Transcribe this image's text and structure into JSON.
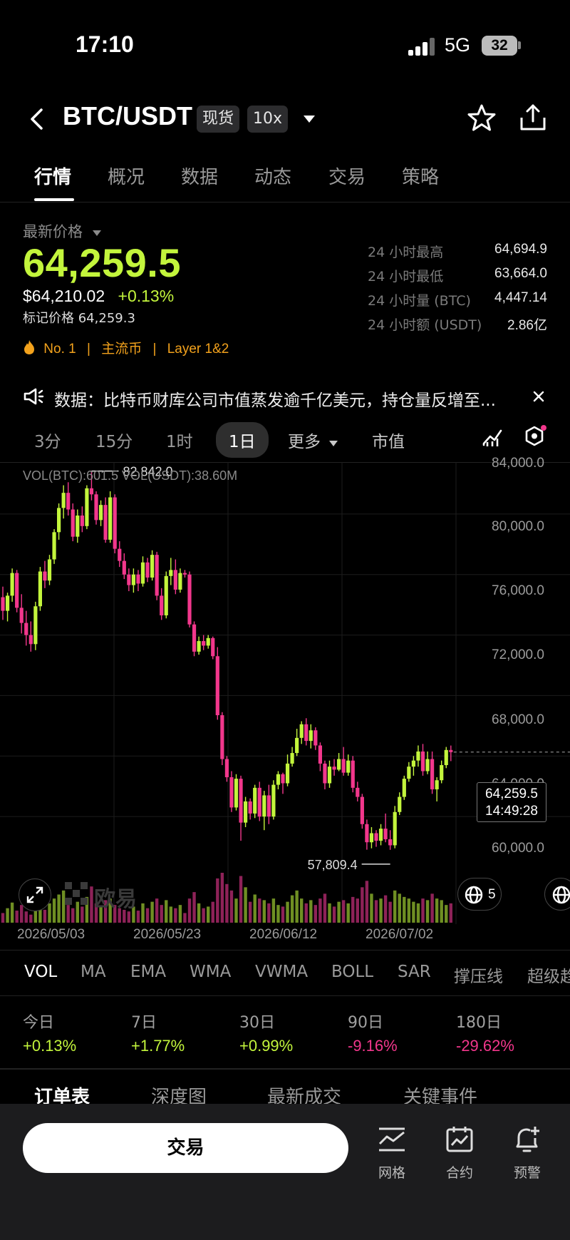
{
  "status_bar": {
    "time": "17:10",
    "network": "5G",
    "battery": "32"
  },
  "header": {
    "pair": "BTC/USDT",
    "tag_market": "现货",
    "tag_leverage": "10x"
  },
  "tabs": [
    "行情",
    "概况",
    "数据",
    "动态",
    "交易",
    "策略"
  ],
  "price": {
    "label": "最新价格",
    "last": "64,259.5",
    "usd": "$64,210.02",
    "change": "+0.13%",
    "mark_label": "标记价格",
    "mark_value": "64,259.3"
  },
  "badges": {
    "rank": "No. 1",
    "sep": "|",
    "category": "主流币",
    "layer": "Layer 1&2"
  },
  "stats": [
    {
      "label": "24 小时最高",
      "value": "64,694.9"
    },
    {
      "label": "24 小时最低",
      "value": "63,664.0"
    },
    {
      "label": "24 小时量 (BTC)",
      "value": "4,447.14"
    },
    {
      "label": "24 小时额 (USDT)",
      "value": "2.86亿"
    }
  ],
  "news": {
    "text": "数据：比特币财库公司市值蒸发逾千亿美元，持仓量反增至..."
  },
  "timeframes": [
    "3分",
    "15分",
    "1时",
    "1日",
    "更多",
    "市值"
  ],
  "chart": {
    "vol_info": "VOL(BTC):601.5 VOL(USDT):38.60M",
    "high_label": "82,842.0",
    "low_label": "57,809.4",
    "y_ticks": [
      "84,000.0",
      "80,000.0",
      "76,000.0",
      "72,000.0",
      "68,000.0",
      "64,000.0",
      "60,000.0"
    ],
    "x_ticks": [
      "2026/05/03",
      "2026/05/23",
      "2026/06/12",
      "2026/07/02"
    ],
    "current_price": "64,259.5",
    "countdown": "14:49:28",
    "watermark": "欧易",
    "badge_count": "5",
    "colors": {
      "up": "#c3f53c",
      "down": "#f2378c"
    }
  },
  "chart_data": {
    "type": "candlestick",
    "ylim": [
      56000,
      84000
    ],
    "x_start": "2026/04/25",
    "x_step_days": 1,
    "candles": [
      [
        74500,
        75200,
        73000,
        73600
      ],
      [
        73600,
        74800,
        72900,
        74600
      ],
      [
        74600,
        76400,
        74200,
        76100
      ],
      [
        76100,
        76300,
        73500,
        73800
      ],
      [
        73800,
        74700,
        72100,
        72800
      ],
      [
        72800,
        73600,
        71300,
        72000
      ],
      [
        72000,
        72900,
        70900,
        71400
      ],
      [
        71400,
        74200,
        71000,
        73900
      ],
      [
        73900,
        76500,
        73600,
        76200
      ],
      [
        76200,
        76900,
        75100,
        75600
      ],
      [
        75600,
        77300,
        75300,
        77000
      ],
      [
        77000,
        79000,
        76700,
        78800
      ],
      [
        78800,
        80700,
        78300,
        80400
      ],
      [
        80400,
        81900,
        79700,
        81400
      ],
      [
        81400,
        82100,
        79900,
        80300
      ],
      [
        80300,
        80700,
        78200,
        78500
      ],
      [
        78500,
        80300,
        78100,
        79900
      ],
      [
        79900,
        80500,
        78800,
        79200
      ],
      [
        79200,
        81900,
        79000,
        81700
      ],
      [
        81700,
        82842,
        80900,
        81300
      ],
      [
        81300,
        81500,
        79300,
        79600
      ],
      [
        79600,
        80900,
        79200,
        80600
      ],
      [
        80600,
        81100,
        78100,
        78300
      ],
      [
        78300,
        81500,
        78100,
        81100
      ],
      [
        81100,
        81300,
        77400,
        77700
      ],
      [
        77700,
        78200,
        76500,
        76900
      ],
      [
        76900,
        77400,
        75700,
        76000
      ],
      [
        76000,
        76400,
        74900,
        75300
      ],
      [
        75300,
        76400,
        74800,
        76000
      ],
      [
        76000,
        76300,
        74900,
        75400
      ],
      [
        75400,
        77200,
        75200,
        76800
      ],
      [
        76800,
        77100,
        75500,
        75800
      ],
      [
        75800,
        77600,
        75600,
        77300
      ],
      [
        77300,
        77500,
        74300,
        74600
      ],
      [
        74600,
        75100,
        73000,
        73300
      ],
      [
        73300,
        76200,
        73100,
        75900
      ],
      [
        75900,
        77100,
        75300,
        76300
      ],
      [
        76300,
        77000,
        74700,
        75000
      ],
      [
        75000,
        76400,
        74800,
        76100
      ],
      [
        76100,
        76300,
        75800,
        76000
      ],
      [
        76000,
        76200,
        72500,
        72700
      ],
      [
        72700,
        72900,
        70600,
        70900
      ],
      [
        70900,
        71900,
        70700,
        71600
      ],
      [
        71600,
        72000,
        71000,
        71300
      ],
      [
        71300,
        72000,
        71100,
        71800
      ],
      [
        71800,
        71900,
        70400,
        70600
      ],
      [
        70600,
        71200,
        66400,
        66700
      ],
      [
        66700,
        66900,
        63400,
        63800
      ],
      [
        63800,
        64000,
        62300,
        62600
      ],
      [
        62600,
        63000,
        60300,
        60600
      ],
      [
        60600,
        62800,
        60400,
        62500
      ],
      [
        62500,
        62700,
        58400,
        59600
      ],
      [
        59600,
        61300,
        59300,
        61000
      ],
      [
        61000,
        61200,
        59800,
        60200
      ],
      [
        60200,
        62100,
        59900,
        61900
      ],
      [
        61900,
        62300,
        59700,
        60000
      ],
      [
        60000,
        61700,
        59100,
        61400
      ],
      [
        61400,
        62100,
        59500,
        60000
      ],
      [
        60000,
        62400,
        59800,
        62100
      ],
      [
        62100,
        63000,
        61800,
        62800
      ],
      [
        62800,
        62900,
        61500,
        62200
      ],
      [
        62200,
        64100,
        62000,
        63500
      ],
      [
        63500,
        64600,
        63300,
        64200
      ],
      [
        64200,
        65800,
        64000,
        65200
      ],
      [
        65200,
        66300,
        64800,
        66100
      ],
      [
        66100,
        66500,
        64700,
        65000
      ],
      [
        65000,
        66100,
        64500,
        65700
      ],
      [
        65700,
        65900,
        64400,
        64700
      ],
      [
        64700,
        64900,
        63000,
        63500
      ],
      [
        63500,
        63700,
        61800,
        62200
      ],
      [
        62200,
        63700,
        61900,
        63300
      ],
      [
        63300,
        63800,
        62700,
        63100
      ],
      [
        63100,
        64200,
        63000,
        63800
      ],
      [
        63800,
        64600,
        62700,
        62900
      ],
      [
        62900,
        64100,
        62700,
        63700
      ],
      [
        63700,
        64000,
        61600,
        61900
      ],
      [
        61900,
        62300,
        61000,
        61300
      ],
      [
        61300,
        61500,
        59200,
        59500
      ],
      [
        59500,
        59800,
        57809,
        58300
      ],
      [
        58300,
        59300,
        57900,
        58900
      ],
      [
        58900,
        59100,
        58000,
        58400
      ],
      [
        58400,
        59500,
        58100,
        59200
      ],
      [
        59200,
        60200,
        58300,
        58500
      ],
      [
        58500,
        59100,
        57800,
        58100
      ],
      [
        58100,
        60700,
        57900,
        60300
      ],
      [
        60300,
        61600,
        60100,
        61300
      ],
      [
        61300,
        62700,
        61100,
        62500
      ],
      [
        62500,
        63600,
        62300,
        63300
      ],
      [
        63300,
        64000,
        62700,
        63700
      ],
      [
        63700,
        64700,
        63300,
        64300
      ],
      [
        64300,
        64800,
        62700,
        63000
      ],
      [
        63000,
        64300,
        62800,
        63800
      ],
      [
        63800,
        64300,
        61500,
        61800
      ],
      [
        61800,
        62600,
        61000,
        62400
      ],
      [
        62400,
        63700,
        62200,
        63400
      ],
      [
        63400,
        64600,
        63200,
        64400
      ],
      [
        64400,
        64694,
        63664,
        64259.5
      ]
    ],
    "volumes": [
      12,
      18,
      25,
      15,
      22,
      14,
      10,
      20,
      28,
      16,
      24,
      30,
      35,
      40,
      22,
      18,
      26,
      20,
      32,
      45,
      24,
      20,
      28,
      30,
      22,
      18,
      16,
      14,
      20,
      15,
      24,
      18,
      26,
      30,
      22,
      28,
      20,
      18,
      22,
      12,
      30,
      38,
      24,
      18,
      20,
      26,
      55,
      62,
      48,
      40,
      30,
      58,
      44,
      26,
      35,
      30,
      28,
      24,
      30,
      22,
      20,
      26,
      34,
      40,
      30,
      24,
      28,
      22,
      30,
      36,
      24,
      20,
      26,
      28,
      24,
      32,
      30,
      44,
      52,
      36,
      28,
      30,
      34,
      26,
      40,
      36,
      32,
      30,
      26,
      24,
      30,
      28,
      36,
      30,
      28,
      22,
      24
    ]
  },
  "indicators": [
    "VOL",
    "MA",
    "EMA",
    "WMA",
    "VWMA",
    "BOLL",
    "SAR",
    "撑压线",
    "超级趋"
  ],
  "performance": [
    {
      "label": "今日",
      "value": "+0.13%",
      "dir": "up"
    },
    {
      "label": "7日",
      "value": "+1.77%",
      "dir": "up"
    },
    {
      "label": "30日",
      "value": "+0.99%",
      "dir": "up"
    },
    {
      "label": "90日",
      "value": "-9.16%",
      "dir": "down"
    },
    {
      "label": "180日",
      "value": "-29.62%",
      "dir": "down"
    }
  ],
  "sub_tabs": [
    "订单表",
    "深度图",
    "最新成交",
    "关键事件"
  ],
  "bottom": {
    "trade": "交易",
    "grid": "网格",
    "contract": "合约",
    "alert": "预警"
  }
}
